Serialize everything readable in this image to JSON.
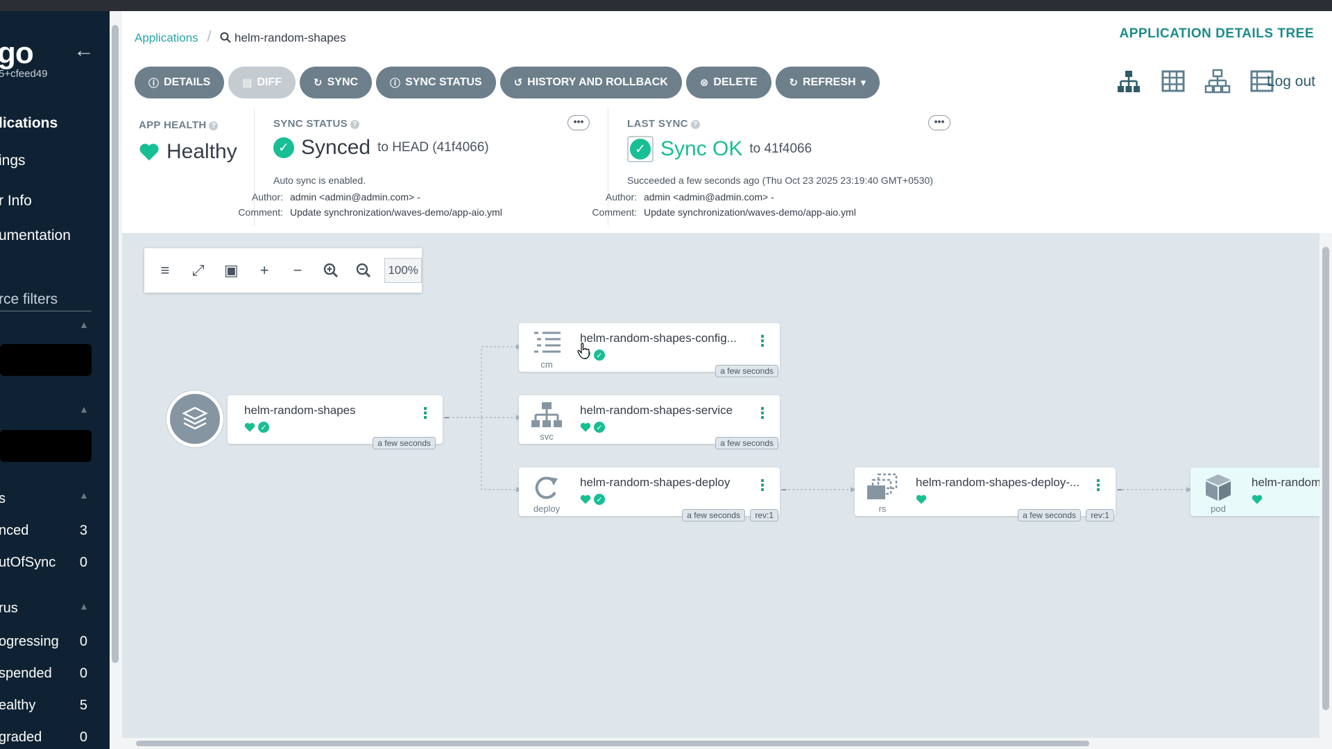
{
  "sidebar": {
    "logo": "go",
    "version": "5+cfeed49",
    "nav": [
      {
        "label": "lications"
      },
      {
        "label": "ings"
      },
      {
        "label": "r Info"
      },
      {
        "label": "umentation"
      }
    ],
    "filters_label": "rce filters",
    "sync_section": {
      "title": "s",
      "rows": [
        {
          "label": "nced",
          "count": "3"
        },
        {
          "label": "utOfSync",
          "count": "0"
        }
      ]
    },
    "health_section": {
      "title": "rus",
      "rows": [
        {
          "label": "ogressing",
          "count": "0"
        },
        {
          "label": "spended",
          "count": "0"
        },
        {
          "label": "ealthy",
          "count": "5"
        },
        {
          "label": "graded",
          "count": "0"
        }
      ]
    }
  },
  "breadcrumb": {
    "link": "Applications",
    "separator": "/",
    "current": "helm-random-shapes"
  },
  "page_title": "APPLICATION DETAILS TREE",
  "toolbar": {
    "details": "DETAILS",
    "diff": "DIFF",
    "sync": "SYNC",
    "sync_status": "SYNC STATUS",
    "history": "HISTORY AND ROLLBACK",
    "delete": "DELETE",
    "refresh": "REFRESH"
  },
  "logout": "Log out",
  "app_health": {
    "label": "APP HEALTH",
    "value": "Healthy"
  },
  "sync_status": {
    "label": "SYNC STATUS",
    "value": "Synced",
    "target": "to HEAD (41f4066)",
    "auto_sync": "Auto sync is enabled.",
    "author_key": "Author:",
    "author": "admin <admin@admin.com> -",
    "comment_key": "Comment:",
    "comment": "Update synchronization/waves-demo/app-aio.yml",
    "more": "•••"
  },
  "last_sync": {
    "label": "LAST SYNC",
    "value": "Sync OK",
    "target": "to 41f4066",
    "succeeded": "Succeeded a few seconds ago (Thu Oct 23 2025 23:19:40 GMT+0530)",
    "author_key": "Author:",
    "author": "admin <admin@admin.com> -",
    "comment_key": "Comment:",
    "comment": "Update synchronization/waves-demo/app-aio.yml",
    "more": "•••"
  },
  "graph_tools": {
    "zoom": "100%"
  },
  "nodes": {
    "app": {
      "name": "helm-random-shapes",
      "age": "a few seconds"
    },
    "cm": {
      "name": "helm-random-shapes-config...",
      "kind": "cm",
      "age": "a few seconds"
    },
    "svc": {
      "name": "helm-random-shapes-service",
      "kind": "svc",
      "age": "a few seconds"
    },
    "deploy": {
      "name": "helm-random-shapes-deploy",
      "kind": "deploy",
      "age": "a few seconds",
      "rev": "rev:1"
    },
    "rs": {
      "name": "helm-random-shapes-deploy-...",
      "kind": "rs",
      "age": "a few seconds",
      "rev": "rev:1"
    },
    "pod": {
      "name": "helm-random",
      "kind": "pod"
    }
  },
  "colors": {
    "sidebar_bg": "#0e2233",
    "accent_teal": "#1d8b8b",
    "status_green": "#18be94",
    "button_gray": "#6d7f8b",
    "canvas_bg": "#dee6eb"
  }
}
